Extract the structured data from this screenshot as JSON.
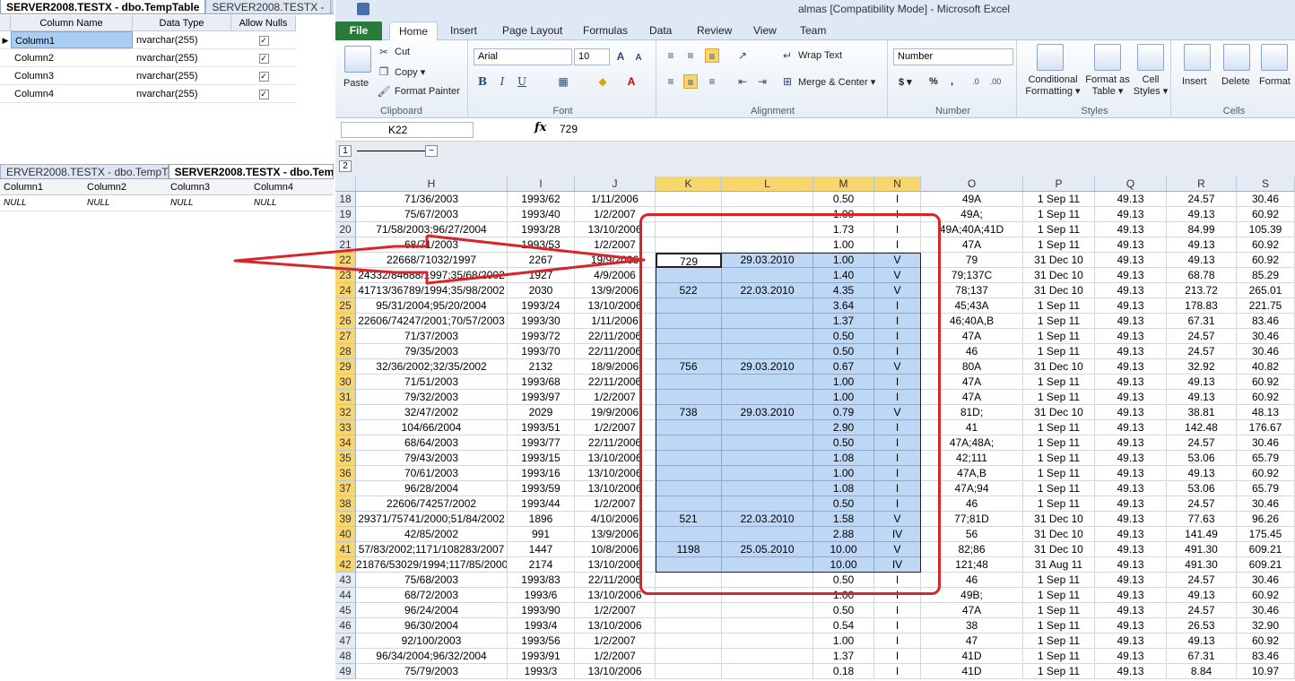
{
  "ssms_top": {
    "tabs": [
      "SERVER2008.TESTX - dbo.TempTable",
      "SERVER2008.TESTX -"
    ],
    "headers": [
      "Column Name",
      "Data Type",
      "Allow Nulls"
    ],
    "rows": [
      {
        "name": "Column1",
        "type": "nvarchar(255)"
      },
      {
        "name": "Column2",
        "type": "nvarchar(255)"
      },
      {
        "name": "Column3",
        "type": "nvarchar(255)"
      },
      {
        "name": "Column4",
        "type": "nvarchar(255)"
      }
    ]
  },
  "ssms_bottom": {
    "tabs": [
      "ERVER2008.TESTX - dbo.TempTable",
      "SERVER2008.TESTX - dbo.TempTa"
    ],
    "headers": [
      "Column1",
      "Column2",
      "Column3",
      "Column4"
    ],
    "row": [
      "NULL",
      "NULL",
      "NULL",
      "NULL"
    ]
  },
  "excel": {
    "title": "almas [Compatibility Mode] - Microsoft Excel",
    "menu": [
      "File",
      "Home",
      "Insert",
      "Page Layout",
      "Formulas",
      "Data",
      "Review",
      "View",
      "Team"
    ],
    "clipboard": {
      "paste": "Paste",
      "cut": "Cut",
      "copy": "Copy ▾",
      "painter": "Format Painter",
      "label": "Clipboard"
    },
    "font": {
      "name": "Arial",
      "size": "10",
      "label": "Font",
      "bold": "B",
      "italic": "I",
      "underline": "U"
    },
    "alignment": {
      "wrap": "Wrap Text",
      "merge": "Merge & Center ▾",
      "label": "Alignment"
    },
    "number": {
      "format": "Number",
      "currency": "$ ▾",
      "percent": "%",
      "comma": ",",
      "label": "Number"
    },
    "styles": {
      "cond": "Conditional Formatting ▾",
      "table": "Format as Table ▾",
      "cell": "Cell Styles ▾",
      "label": "Styles"
    },
    "cells": {
      "insert": "Insert",
      "delete": "Delete",
      "format": "Format",
      "label": "Cells"
    },
    "namebox": "K22",
    "fx": "fx",
    "formula": "729",
    "outline_levels": [
      "1",
      "2"
    ],
    "columns": [
      "H",
      "I",
      "J",
      "K",
      "L",
      "M",
      "N",
      "O",
      "P",
      "Q",
      "R",
      "S"
    ],
    "rows": [
      [
        "18",
        "71/36/2003",
        "1993/62",
        "1/11/2006",
        "",
        "",
        "0.50",
        "I",
        "49A",
        "1 Sep 11",
        "49.13",
        "24.57",
        "30.46"
      ],
      [
        "19",
        "75/67/2003",
        "1993/40",
        "1/2/2007",
        "",
        "",
        "1.00",
        "I",
        "49A;",
        "1 Sep 11",
        "49.13",
        "49.13",
        "60.92"
      ],
      [
        "20",
        "71/58/2003;96/27/2004",
        "1993/28",
        "13/10/2006",
        "",
        "",
        "1.73",
        "I",
        "49A;40A;41D",
        "1 Sep 11",
        "49.13",
        "84.99",
        "105.39"
      ],
      [
        "21",
        "68/71/2003",
        "1993/53",
        "1/2/2007",
        "",
        "",
        "1.00",
        "I",
        "47A",
        "1 Sep 11",
        "49.13",
        "49.13",
        "60.92"
      ],
      [
        "22",
        "22668/71032/1997",
        "2267",
        "19/9/2006",
        "729",
        "29.03.2010",
        "1.00",
        "V",
        "79",
        "31 Dec 10",
        "49.13",
        "49.13",
        "60.92"
      ],
      [
        "23",
        "24332/84688/1997;35/68/2002",
        "1927",
        "4/9/2006",
        "",
        "",
        "1.40",
        "V",
        "79;137C",
        "31 Dec 10",
        "49.13",
        "68.78",
        "85.29"
      ],
      [
        "24",
        "41713/36789/1994;35/98/2002",
        "2030",
        "13/9/2006",
        "522",
        "22.03.2010",
        "4.35",
        "V",
        "78;137",
        "31 Dec 10",
        "49.13",
        "213.72",
        "265.01"
      ],
      [
        "25",
        "95/31/2004;95/20/2004",
        "1993/24",
        "13/10/2006",
        "",
        "",
        "3.64",
        "I",
        "45;43A",
        "1 Sep 11",
        "49.13",
        "178.83",
        "221.75"
      ],
      [
        "26",
        "22606/74247/2001;70/57/2003",
        "1993/30",
        "1/11/2006",
        "",
        "",
        "1.37",
        "I",
        "46;40A,B",
        "1 Sep 11",
        "49.13",
        "67.31",
        "83.46"
      ],
      [
        "27",
        "71/37/2003",
        "1993/72",
        "22/11/2006",
        "",
        "",
        "0.50",
        "I",
        "47A",
        "1 Sep 11",
        "49.13",
        "24.57",
        "30.46"
      ],
      [
        "28",
        "79/35/2003",
        "1993/70",
        "22/11/2006",
        "",
        "",
        "0.50",
        "I",
        "46",
        "1 Sep 11",
        "49.13",
        "24.57",
        "30.46"
      ],
      [
        "29",
        "32/36/2002;32/35/2002",
        "2132",
        "18/9/2006",
        "756",
        "29.03.2010",
        "0.67",
        "V",
        "80A",
        "31 Dec 10",
        "49.13",
        "32.92",
        "40.82"
      ],
      [
        "30",
        "71/51/2003",
        "1993/68",
        "22/11/2006",
        "",
        "",
        "1.00",
        "I",
        "47A",
        "1 Sep 11",
        "49.13",
        "49.13",
        "60.92"
      ],
      [
        "31",
        "79/32/2003",
        "1993/97",
        "1/2/2007",
        "",
        "",
        "1.00",
        "I",
        "47A",
        "1 Sep 11",
        "49.13",
        "49.13",
        "60.92"
      ],
      [
        "32",
        "32/47/2002",
        "2029",
        "19/9/2006",
        "738",
        "29.03.2010",
        "0.79",
        "V",
        "81D;",
        "31 Dec 10",
        "49.13",
        "38.81",
        "48.13"
      ],
      [
        "33",
        "104/66/2004",
        "1993/51",
        "1/2/2007",
        "",
        "",
        "2.90",
        "I",
        "41",
        "1 Sep 11",
        "49.13",
        "142.48",
        "176.67"
      ],
      [
        "34",
        "68/64/2003",
        "1993/77",
        "22/11/2006",
        "",
        "",
        "0.50",
        "I",
        "47A;48A;",
        "1 Sep 11",
        "49.13",
        "24.57",
        "30.46"
      ],
      [
        "35",
        "79/43/2003",
        "1993/15",
        "13/10/2006",
        "",
        "",
        "1.08",
        "I",
        "42;111",
        "1 Sep 11",
        "49.13",
        "53.06",
        "65.79"
      ],
      [
        "36",
        "70/61/2003",
        "1993/16",
        "13/10/2006",
        "",
        "",
        "1.00",
        "I",
        "47A,B",
        "1 Sep 11",
        "49.13",
        "49.13",
        "60.92"
      ],
      [
        "37",
        "96/28/2004",
        "1993/59",
        "13/10/2006",
        "",
        "",
        "1.08",
        "I",
        "47A;94",
        "1 Sep 11",
        "49.13",
        "53.06",
        "65.79"
      ],
      [
        "38",
        "22606/74257/2002",
        "1993/44",
        "1/2/2007",
        "",
        "",
        "0.50",
        "I",
        "46",
        "1 Sep 11",
        "49.13",
        "24.57",
        "30.46"
      ],
      [
        "39",
        "29371/75741/2000;51/84/2002",
        "1896",
        "4/10/2006",
        "521",
        "22.03.2010",
        "1.58",
        "V",
        "77;81D",
        "31 Dec 10",
        "49.13",
        "77.63",
        "96.26"
      ],
      [
        "40",
        "42/85/2002",
        "991",
        "13/9/2006",
        "",
        "",
        "2.88",
        "IV",
        "56",
        "31 Dec 10",
        "49.13",
        "141.49",
        "175.45"
      ],
      [
        "41",
        "57/83/2002;1171/108283/2007",
        "1447",
        "10/8/2006",
        "1198",
        "25.05.2010",
        "10.00",
        "V",
        "82;86",
        "31 Dec 10",
        "49.13",
        "491.30",
        "609.21"
      ],
      [
        "42",
        "21876/53029/1994;117/85/2000",
        "2174",
        "13/10/2006",
        "",
        "",
        "10.00",
        "IV",
        "121;48",
        "31 Aug 11",
        "49.13",
        "491.30",
        "609.21"
      ],
      [
        "43",
        "75/68/2003",
        "1993/83",
        "22/11/2006",
        "",
        "",
        "0.50",
        "I",
        "46",
        "1 Sep 11",
        "49.13",
        "24.57",
        "30.46"
      ],
      [
        "44",
        "68/72/2003",
        "1993/6",
        "13/10/2006",
        "",
        "",
        "1.00",
        "I",
        "49B;",
        "1 Sep 11",
        "49.13",
        "49.13",
        "60.92"
      ],
      [
        "45",
        "96/24/2004",
        "1993/90",
        "1/2/2007",
        "",
        "",
        "0.50",
        "I",
        "47A",
        "1 Sep 11",
        "49.13",
        "24.57",
        "30.46"
      ],
      [
        "46",
        "96/30/2004",
        "1993/4",
        "13/10/2006",
        "",
        "",
        "0.54",
        "I",
        "38",
        "1 Sep 11",
        "49.13",
        "26.53",
        "32.90"
      ],
      [
        "47",
        "92/100/2003",
        "1993/56",
        "1/2/2007",
        "",
        "",
        "1.00",
        "I",
        "47",
        "1 Sep 11",
        "49.13",
        "49.13",
        "60.92"
      ],
      [
        "48",
        "96/34/2004;96/32/2004",
        "1993/91",
        "1/2/2007",
        "",
        "",
        "1.37",
        "I",
        "41D",
        "1 Sep 11",
        "49.13",
        "67.31",
        "83.46"
      ],
      [
        "49",
        "75/79/2003",
        "1993/3",
        "13/10/2006",
        "",
        "",
        "0.18",
        "I",
        "41D",
        "1 Sep 11",
        "49.13",
        "8.84",
        "10.97"
      ]
    ]
  }
}
